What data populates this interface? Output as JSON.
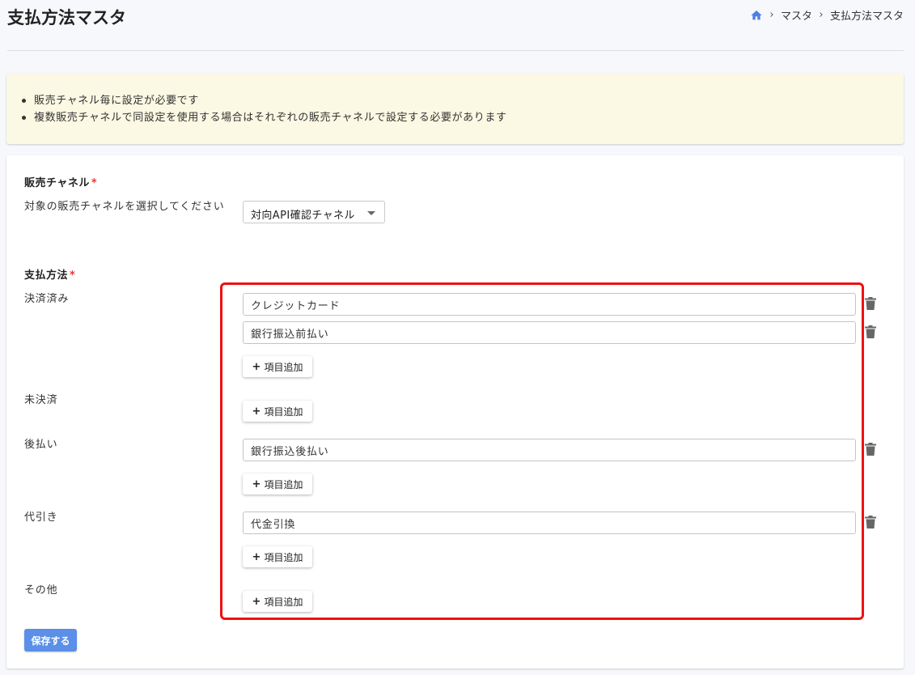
{
  "header": {
    "title": "支払方法マスタ",
    "breadcrumb": [
      "マスタ",
      "支払方法マスタ"
    ]
  },
  "notice": {
    "items": [
      "販売チャネル毎に設定が必要です",
      "複数販売チャネルで同設定を使用する場合はそれぞれの販売チャネルで設定する必要があります"
    ]
  },
  "sales_channel": {
    "title": "販売チャネル",
    "required_mark": "*",
    "label": "対象の販売チャネルを選択してください",
    "selected": "対向API確認チャネル"
  },
  "payment_methods": {
    "title": "支払方法",
    "required_mark": "*",
    "add_label": "項目追加",
    "groups": [
      {
        "label": "決済済み",
        "items": [
          "クレジットカード",
          "銀行振込前払い"
        ]
      },
      {
        "label": "未決済",
        "items": []
      },
      {
        "label": "後払い",
        "items": [
          "銀行振込後払い"
        ]
      },
      {
        "label": "代引き",
        "items": [
          "代金引換"
        ]
      },
      {
        "label": "その他",
        "items": []
      }
    ]
  },
  "save_label": "保存する",
  "colors": {
    "accent": "#5b8fe8",
    "required": "#e53935",
    "highlight": "#ee1111",
    "notice_bg": "#fbf8e3"
  }
}
